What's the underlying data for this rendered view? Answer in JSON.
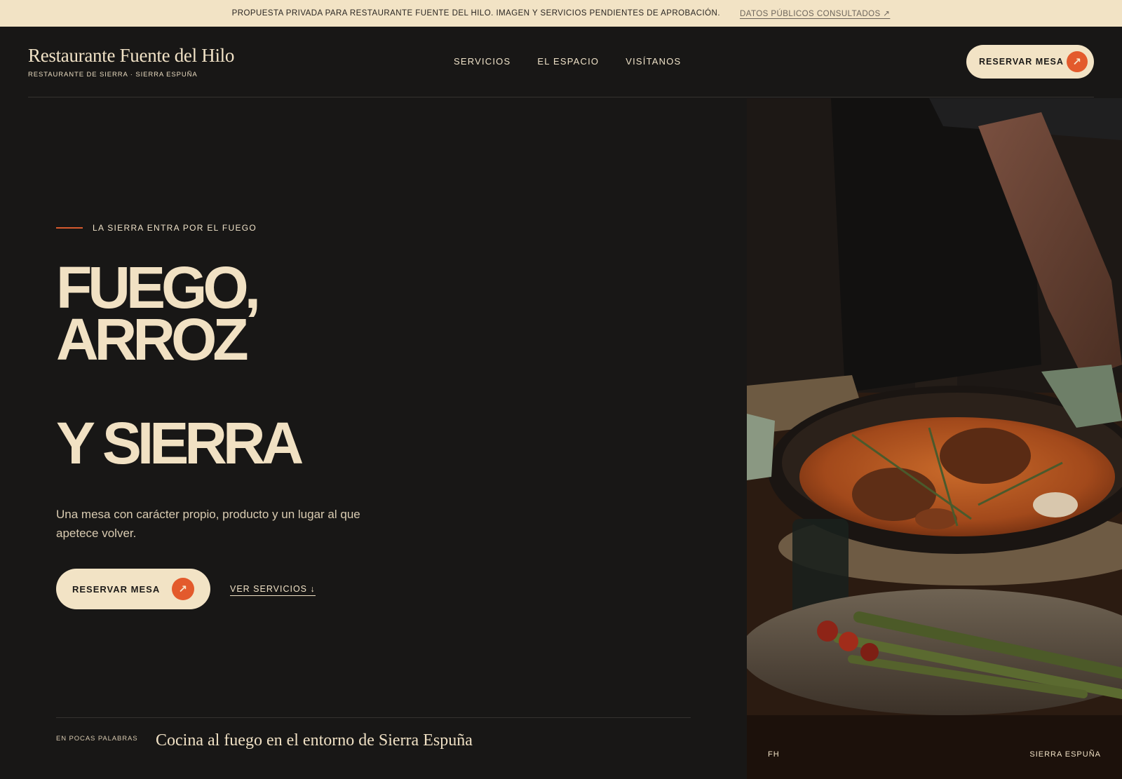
{
  "announcement": {
    "notice": "PROPUESTA PRIVADA PARA RESTAURANTE FUENTE DEL HILO. IMAGEN Y SERVICIOS PENDIENTES DE APROBACIÓN.",
    "link_label": "DATOS PÚBLICOS CONSULTADOS ↗"
  },
  "header": {
    "brand_name": "Restaurante Fuente del Hilo",
    "brand_tagline": "RESTAURANTE DE SIERRA · SIERRA ESPUÑA",
    "nav": [
      "SERVICIOS",
      "EL ESPACIO",
      "VISÍTANOS"
    ],
    "cta_label": "RESERVAR MESA",
    "cta_icon": "arrow-up-right-icon"
  },
  "hero": {
    "eyebrow": "LA SIERRA ENTRA POR EL FUEGO",
    "headline": [
      "FUEGO,",
      "ARROZ",
      "Y SIERRA"
    ],
    "lead": "Una mesa con carácter propio, producto y un lugar al que apetece volver.",
    "primary_cta": "RESERVAR MESA",
    "secondary_cta": "VER SERVICIOS ↓"
  },
  "summary": {
    "label": "EN POCAS PALABRAS",
    "text": "Cocina al fuego en el entorno de Sierra Espuña"
  },
  "photo": {
    "caption_left": "FH",
    "caption_right": "SIERRA ESPUÑA"
  },
  "colors": {
    "background": "#181716",
    "cream": "#f2e3c5",
    "accent": "#e35a2c"
  }
}
